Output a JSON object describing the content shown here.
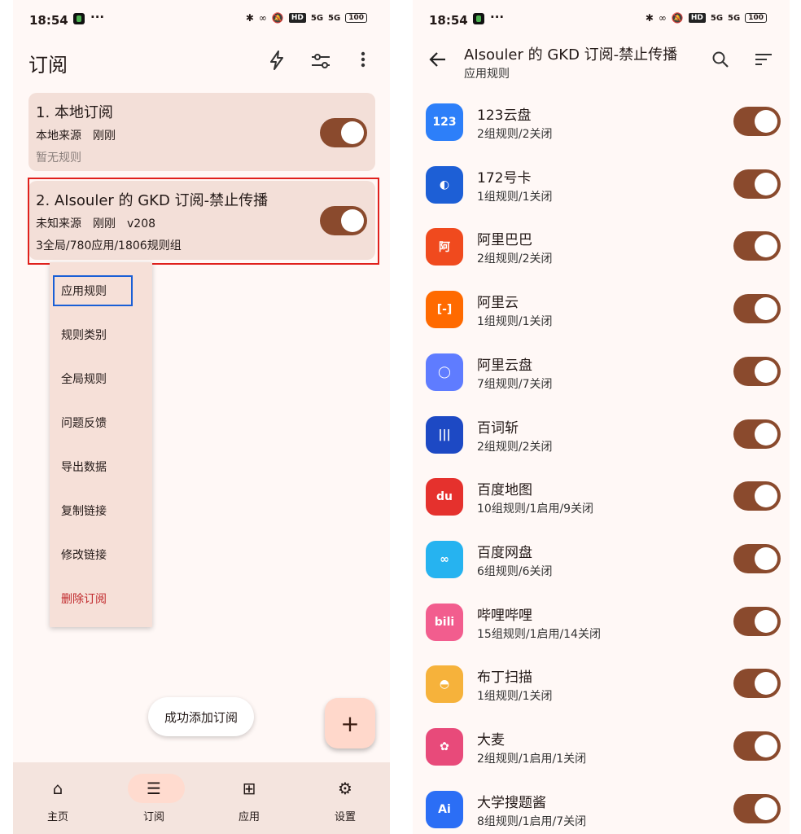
{
  "status": {
    "time": "18:54",
    "dots": "···",
    "hd": "HD",
    "sig1": "5G",
    "sig2": "5G",
    "battery": "100"
  },
  "left": {
    "title": "订阅",
    "icons": [
      "flash-icon",
      "tune-icon",
      "more-vertical-icon"
    ],
    "cards": [
      {
        "title": "1. 本地订阅",
        "line2": "本地来源　刚刚",
        "line3": "暂无规则",
        "enabled": true
      },
      {
        "title": "2. AIsouler 的 GKD 订阅-禁止传播",
        "line2": "未知来源　刚刚　v208",
        "line3": "3全局/780应用/1806规则组",
        "enabled": true
      }
    ],
    "menu": [
      "应用规则",
      "规则类别",
      "全局规则",
      "问题反馈",
      "导出数据",
      "复制链接",
      "修改链接",
      "删除订阅"
    ],
    "snackbar": "成功添加订阅",
    "fab": "+",
    "nav": [
      {
        "label": "主页",
        "icon": "home-icon",
        "glyph": "⌂"
      },
      {
        "label": "订阅",
        "icon": "list-icon",
        "glyph": "☰"
      },
      {
        "label": "应用",
        "icon": "apps-grid-icon",
        "glyph": "⊞"
      },
      {
        "label": "设置",
        "icon": "gear-icon",
        "glyph": "⚙"
      }
    ]
  },
  "right": {
    "title": "AIsouler 的 GKD 订阅-禁止传播",
    "subtitle": "应用规则",
    "apps": [
      {
        "name": "123云盘",
        "rules": "2组规则/2关闭",
        "logo_text": "123",
        "color": "#2d7ff9"
      },
      {
        "name": "172号卡",
        "rules": "1组规则/1关闭",
        "logo_text": "◐",
        "color": "#1d5fd6"
      },
      {
        "name": "阿里巴巴",
        "rules": "2组规则/2关闭",
        "logo_text": "阿",
        "color": "#f04a1e"
      },
      {
        "name": "阿里云",
        "rules": "1组规则/1关闭",
        "logo_text": "[-]",
        "color": "#ff6a00"
      },
      {
        "name": "阿里云盘",
        "rules": "7组规则/7关闭",
        "logo_text": "◯",
        "color": "#5f7cff"
      },
      {
        "name": "百词斩",
        "rules": "2组规则/2关闭",
        "logo_text": "|||",
        "color": "#1d49c4"
      },
      {
        "name": "百度地图",
        "rules": "10组规则/1启用/9关闭",
        "logo_text": "du",
        "color": "#e5312d"
      },
      {
        "name": "百度网盘",
        "rules": "6组规则/6关闭",
        "logo_text": "∞",
        "color": "#26b3f0"
      },
      {
        "name": "哔哩哔哩",
        "rules": "15组规则/1启用/14关闭",
        "logo_text": "bili",
        "color": "#f25d8e"
      },
      {
        "name": "布丁扫描",
        "rules": "1组规则/1关闭",
        "logo_text": "◓",
        "color": "#f6b23b"
      },
      {
        "name": "大麦",
        "rules": "2组规则/1启用/1关闭",
        "logo_text": "✿",
        "color": "#e84a7a"
      },
      {
        "name": "大学搜题酱",
        "rules": "8组规则/1启用/7关闭",
        "logo_text": "Ai",
        "color": "#2b6ef5"
      }
    ]
  }
}
